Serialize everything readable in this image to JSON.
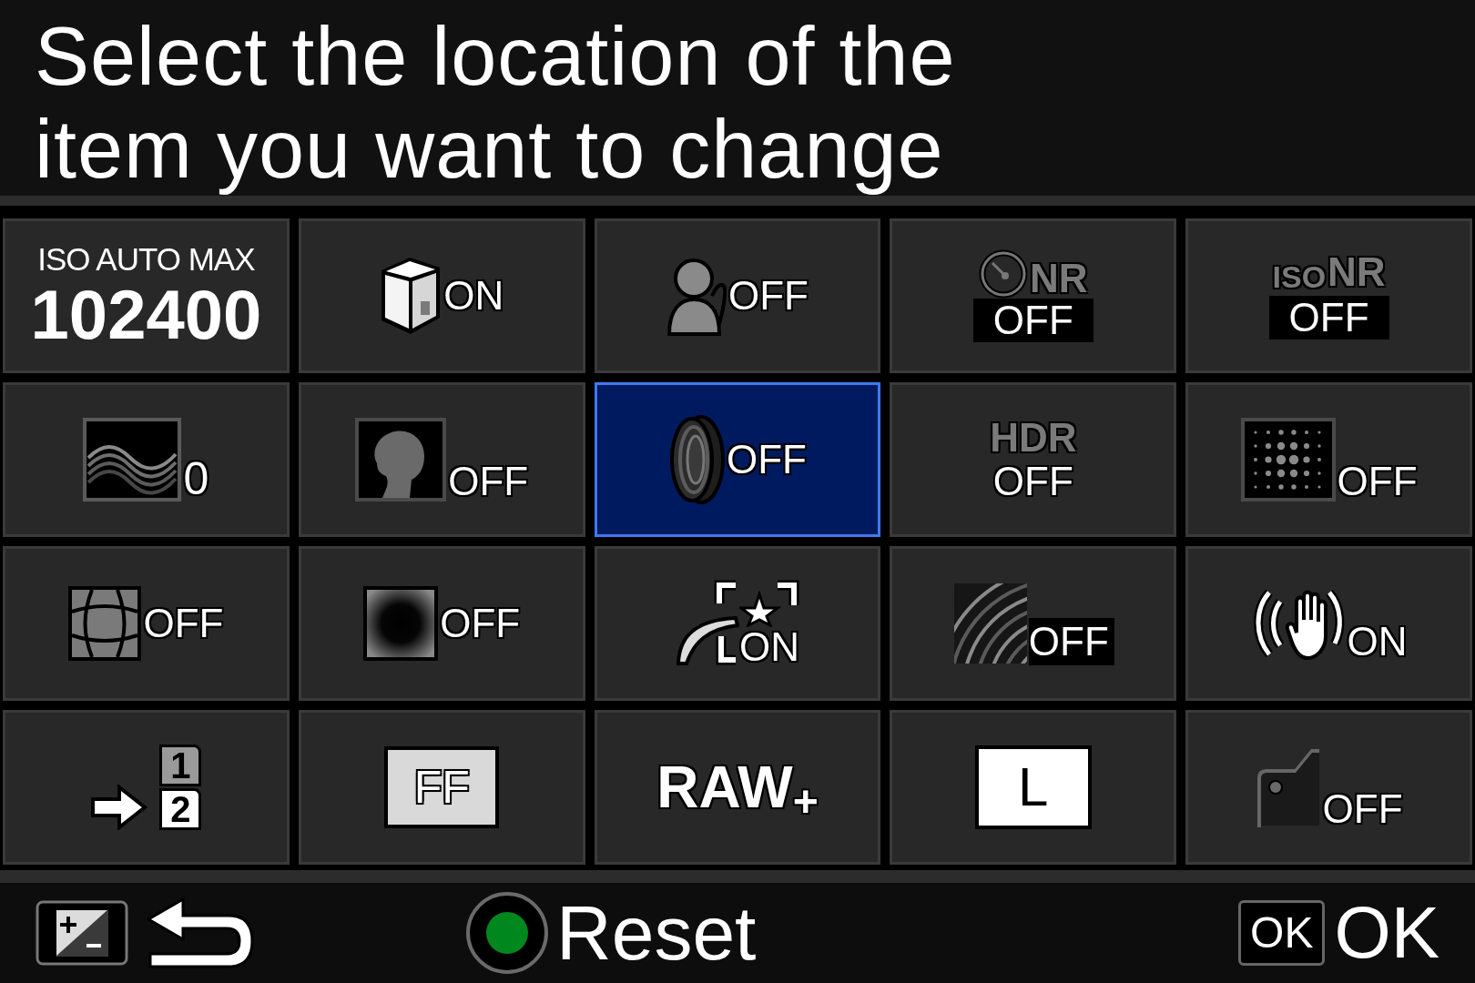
{
  "header": {
    "title": "Select the location of the item you want to change"
  },
  "grid": {
    "cells": [
      {
        "kind": "iso",
        "selected": false,
        "label": "ISO AUTO MAX",
        "value": "102400"
      },
      {
        "kind": "cube",
        "selected": false,
        "value": "ON"
      },
      {
        "kind": "person",
        "selected": false,
        "value": "OFF"
      },
      {
        "kind": "dial",
        "selected": false,
        "label": "NR",
        "value": "OFF"
      },
      {
        "kind": "isonr",
        "selected": false,
        "prefix": "ISO",
        "label": "NR",
        "value": "OFF"
      },
      {
        "kind": "waves",
        "selected": false,
        "value": "0"
      },
      {
        "kind": "portrait",
        "selected": false,
        "value": "OFF"
      },
      {
        "kind": "lens",
        "selected": true,
        "value": "OFF"
      },
      {
        "kind": "hdr",
        "selected": false,
        "label": "HDR",
        "value": "OFF"
      },
      {
        "kind": "dots",
        "selected": false,
        "value": "OFF"
      },
      {
        "kind": "distortion",
        "selected": false,
        "value": "OFF"
      },
      {
        "kind": "vignette",
        "selected": false,
        "value": "OFF"
      },
      {
        "kind": "star",
        "selected": false,
        "value": "ON"
      },
      {
        "kind": "moire",
        "selected": false,
        "value": "OFF"
      },
      {
        "kind": "shake",
        "selected": false,
        "value": "ON"
      },
      {
        "kind": "slots",
        "selected": false,
        "slots": [
          {
            "label": "1",
            "selected": false
          },
          {
            "label": "2",
            "selected": true
          }
        ]
      },
      {
        "kind": "format",
        "selected": false,
        "value": "FF"
      },
      {
        "kind": "raw",
        "selected": false,
        "value": "RAW",
        "suffix": "+"
      },
      {
        "kind": "size",
        "selected": false,
        "value": "L"
      },
      {
        "kind": "card",
        "selected": false,
        "value": "OFF"
      }
    ]
  },
  "footer": {
    "reset_label": "Reset",
    "ok_key": "OK",
    "ok_label": "OK"
  }
}
